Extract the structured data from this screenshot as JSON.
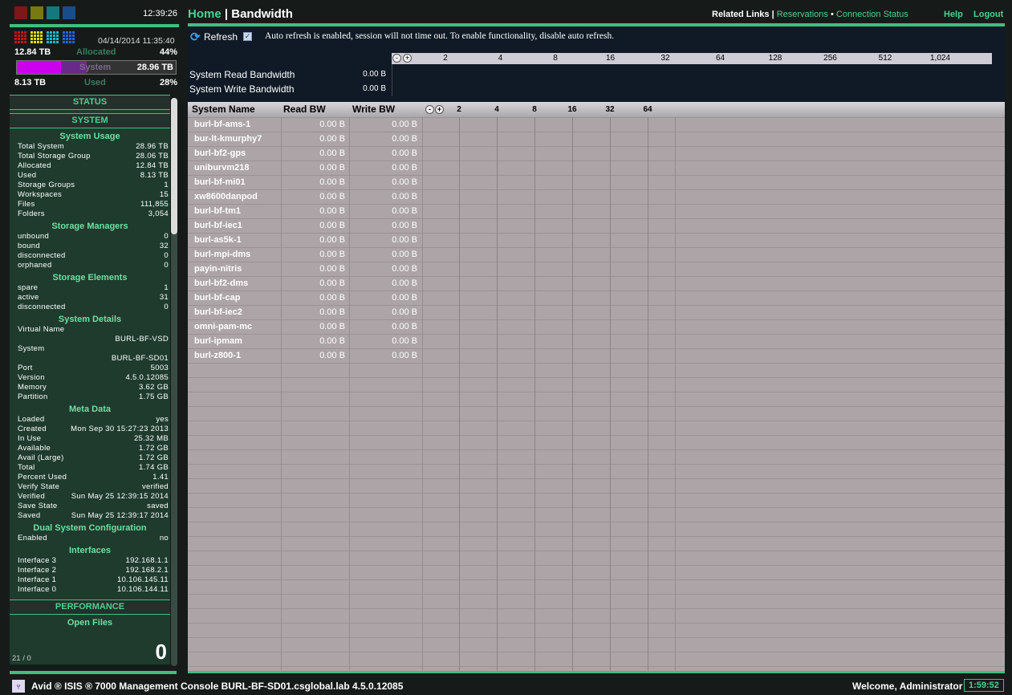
{
  "header": {
    "clock": "12:39:26",
    "home": "Home",
    "separator": "|",
    "page_title": "Bandwidth",
    "related_links_label": "Related Links |",
    "links": [
      "Reservations",
      "Connection Status"
    ],
    "help": "Help",
    "logout": "Logout"
  },
  "colors": {
    "accent": "#3fbf80",
    "red": "#cc1111",
    "yellow": "#dddd00",
    "cyan": "#11bbcc",
    "blue": "#2266dd",
    "system_bar": "#cc00ee"
  },
  "capacity": {
    "timestamp": "04/14/2014 11:35:40",
    "allocated_value": "12.84 TB",
    "allocated_label": "Allocated",
    "allocated_pct": "44%",
    "system_label": "System",
    "system_value": "28.96 TB",
    "used_value": "8.13 TB",
    "used_label": "Used",
    "used_pct": "28%",
    "allocated_fraction": 0.44,
    "used_fraction": 0.28
  },
  "sidebar": {
    "status": "STATUS",
    "system": "SYSTEM",
    "performance": "PERFORMANCE",
    "open_files_title": "Open Files",
    "open_files_count": "0",
    "open_files_ratio": "21 / 0",
    "sections": [
      {
        "title": "System Usage",
        "items": [
          [
            "Total System",
            "28.96 TB"
          ],
          [
            "Total Storage Group",
            "28.06 TB"
          ],
          [
            "Allocated",
            "12.84 TB"
          ],
          [
            "Used",
            "8.13 TB"
          ],
          [
            "Storage Groups",
            "1"
          ],
          [
            "Workspaces",
            "15"
          ],
          [
            "Files",
            "111,855"
          ],
          [
            "Folders",
            "3,054"
          ]
        ]
      },
      {
        "title": "Storage Managers",
        "items": [
          [
            "unbound",
            "0"
          ],
          [
            "bound",
            "32"
          ],
          [
            "disconnected",
            "0"
          ],
          [
            "orphaned",
            "0"
          ]
        ]
      },
      {
        "title": "Storage Elements",
        "items": [
          [
            "spare",
            "1"
          ],
          [
            "active",
            "31"
          ],
          [
            "disconnected",
            "0"
          ]
        ]
      },
      {
        "title": "System Details",
        "items": [
          [
            "Virtual Name",
            ""
          ],
          [
            "",
            "BURL-BF-VSD"
          ],
          [
            "System",
            ""
          ],
          [
            "",
            "BURL-BF-SD01"
          ],
          [
            "Port",
            "5003"
          ],
          [
            "Version",
            "4.5.0.12085"
          ],
          [
            "Memory",
            "3.62 GB"
          ],
          [
            "Partition",
            "1.75 GB"
          ]
        ]
      },
      {
        "title": "Meta Data",
        "items": [
          [
            "Loaded",
            "yes"
          ],
          [
            "Created",
            "Mon Sep 30 15:27:23 2013"
          ],
          [
            "In Use",
            "25.32 MB"
          ],
          [
            "Available",
            "1.72 GB"
          ],
          [
            "Avail (Large)",
            "1.72 GB"
          ],
          [
            "Total",
            "1.74 GB"
          ],
          [
            "Percent Used",
            "1.41"
          ],
          [
            "Verify State",
            "verified"
          ],
          [
            "Verified",
            "Sun May 25 12:39:15 2014"
          ],
          [
            "Save State",
            "saved"
          ],
          [
            "Saved",
            "Sun May 25 12:39:17 2014"
          ]
        ]
      },
      {
        "title": "Dual System Configuration",
        "items": [
          [
            "Enabled",
            "no"
          ]
        ]
      },
      {
        "title": "Interfaces",
        "items": [
          [
            "Interface 3",
            "192.168.1.1"
          ],
          [
            "Interface 2",
            "192.168.2.1"
          ],
          [
            "Interface 1",
            "10.106.145.11"
          ],
          [
            "Interface 0",
            "10.106.144.11"
          ]
        ]
      }
    ]
  },
  "toolbar": {
    "refresh": "Refresh",
    "auto_refresh_checked": true,
    "notice": "Auto refresh is enabled, session will not time out. To enable functionality, disable auto refresh."
  },
  "system_bw": {
    "read_label": "System Read Bandwidth",
    "read_value": "0.00 B",
    "write_label": "System Write Bandwidth",
    "write_value": "0.00 B",
    "scale": [
      "2",
      "4",
      "8",
      "16",
      "32",
      "64",
      "128",
      "256",
      "512",
      "1,024"
    ]
  },
  "table": {
    "columns": [
      "System Name",
      "Read BW",
      "Write BW"
    ],
    "scale": [
      "2",
      "4",
      "8",
      "16",
      "32",
      "64"
    ],
    "rows": [
      [
        "burl-bf-ams-1",
        "0.00 B",
        "0.00 B"
      ],
      [
        "bur-lt-kmurphy7",
        "0.00 B",
        "0.00 B"
      ],
      [
        "burl-bf2-gps",
        "0.00 B",
        "0.00 B"
      ],
      [
        "uniburvm218",
        "0.00 B",
        "0.00 B"
      ],
      [
        "burl-bf-mi01",
        "0.00 B",
        "0.00 B"
      ],
      [
        "xw8600danpod",
        "0.00 B",
        "0.00 B"
      ],
      [
        "burl-bf-tm1",
        "0.00 B",
        "0.00 B"
      ],
      [
        "burl-bf-iec1",
        "0.00 B",
        "0.00 B"
      ],
      [
        "burl-as5k-1",
        "0.00 B",
        "0.00 B"
      ],
      [
        "burl-mpi-dms",
        "0.00 B",
        "0.00 B"
      ],
      [
        "payin-nitris",
        "0.00 B",
        "0.00 B"
      ],
      [
        "burl-bf2-dms",
        "0.00 B",
        "0.00 B"
      ],
      [
        "burl-bf-cap",
        "0.00 B",
        "0.00 B"
      ],
      [
        "burl-bf-iec2",
        "0.00 B",
        "0.00 B"
      ],
      [
        "omni-pam-mc",
        "0.00 B",
        "0.00 B"
      ],
      [
        "burl-ipmam",
        "0.00 B",
        "0.00 B"
      ],
      [
        "burl-z800-1",
        "0.00 B",
        "0.00 B"
      ]
    ]
  },
  "footer": {
    "product": "Avid ® ISIS ® 7000  Management Console  BURL-BF-SD01.csglobal.lab  4.5.0.12085",
    "welcome": "Welcome, Administrator",
    "timer": "1:59:52"
  }
}
